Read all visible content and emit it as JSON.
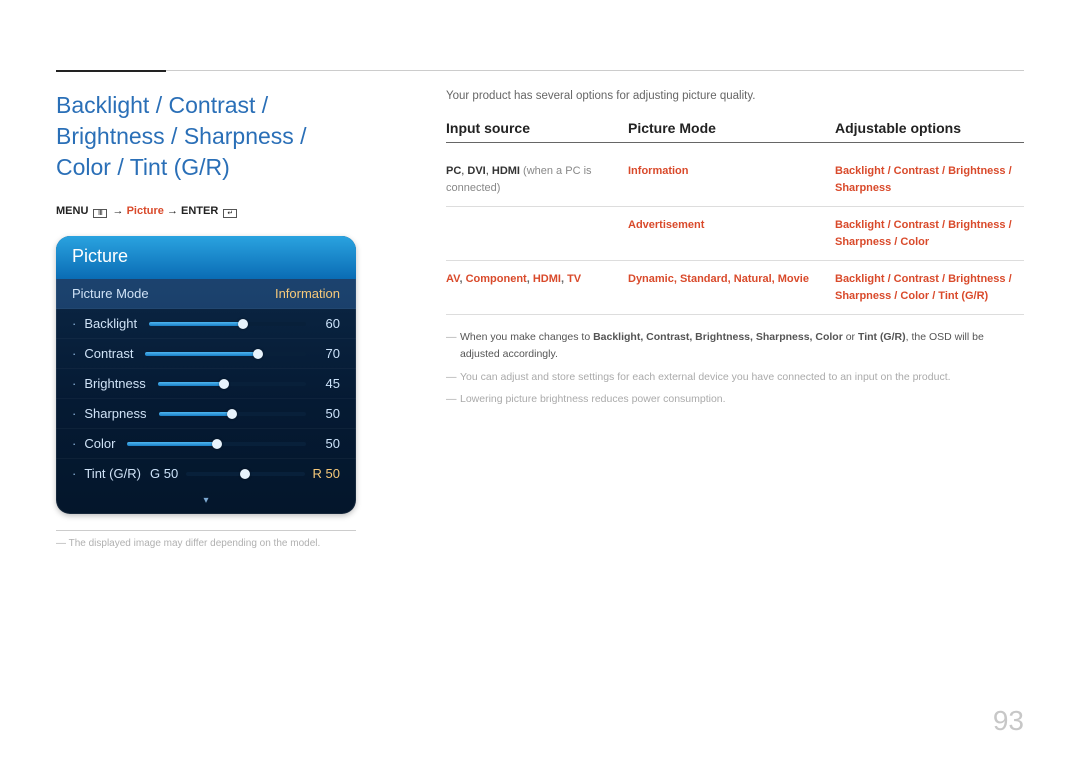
{
  "page_number": "93",
  "heading": "Backlight / Contrast / Brightness / Sharpness / Color / Tint (G/R)",
  "breadcrumb": {
    "menu": "MENU",
    "picture": "Picture",
    "enter": "ENTER",
    "arrow": "→"
  },
  "osd": {
    "title": "Picture",
    "mode_label": "Picture Mode",
    "mode_value": "Information",
    "items": [
      {
        "label": "Backlight",
        "value": "60",
        "percent": 60
      },
      {
        "label": "Contrast",
        "value": "70",
        "percent": 70
      },
      {
        "label": "Brightness",
        "value": "45",
        "percent": 45
      },
      {
        "label": "Sharpness",
        "value": "50",
        "percent": 50
      },
      {
        "label": "Color",
        "value": "50",
        "percent": 50
      }
    ],
    "tint": {
      "label": "Tint (G/R)",
      "g": "G 50",
      "r": "R 50"
    }
  },
  "left_footnote": "The displayed image may differ depending on the model.",
  "intro": "Your product has several options for adjusting picture quality.",
  "table": {
    "headers": {
      "c1": "Input source",
      "c2": "Picture Mode",
      "c3": "Adjustable options"
    },
    "rows": [
      {
        "c1_parts": [
          "PC",
          ", ",
          "DVI",
          ", ",
          "HDMI",
          " (when a PC is connected)"
        ],
        "c2": "Information",
        "c3": "Backlight / Contrast / Brightness / Sharpness"
      },
      {
        "c1_parts": [],
        "c2": "Advertisement",
        "c3": "Backlight / Contrast / Brightness / Sharpness / Color"
      },
      {
        "c1_parts": [
          "AV",
          ", ",
          "Component",
          ", ",
          "HDMI",
          ", ",
          "TV"
        ],
        "c2": "Dynamic, Standard, Natural, Movie",
        "c3": "Backlight / Contrast / Brightness / Sharpness / Color / Tint (G/R)"
      }
    ]
  },
  "notes": [
    {
      "prefix": "When you make changes to ",
      "bold_joined": "Backlight, Contrast, Brightness, Sharpness, Color",
      "mid": " or ",
      "bold2": "Tint (G/R)",
      "suffix": ", the OSD will be adjusted accordingly."
    },
    {
      "text": "You can adjust and store settings for each external device you have connected to an input on the product."
    },
    {
      "text": "Lowering picture brightness reduces power consumption."
    }
  ]
}
